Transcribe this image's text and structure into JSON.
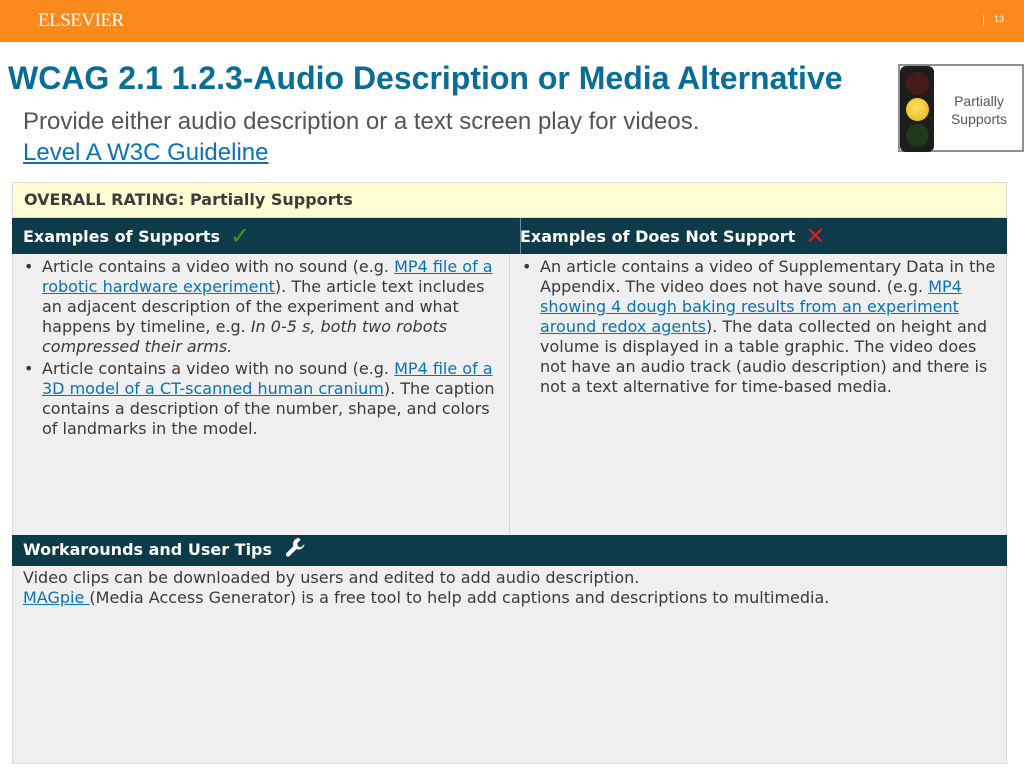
{
  "header": {
    "brand": "ELSEVIER",
    "page_number": "13"
  },
  "slide": {
    "title": "WCAG 2.1 1.2.3-Audio Description or Media Alternative",
    "subtitle": "Provide either audio description or a text screen play for videos.",
    "guideline_link": "Level A W3C Guideline"
  },
  "traffic_light": {
    "state": "yellow",
    "label_line1": "Partially",
    "label_line2": "Supports"
  },
  "table": {
    "rating": "OVERALL RATING: Partially Supports",
    "supports_header": "Examples of Supports",
    "not_supports_header": "Examples of Does Not Support",
    "supports_icon": "check-icon",
    "not_supports_icon": "cross-icon",
    "supports_items": [
      {
        "pre": "Article contains a video with no sound (e.g. ",
        "link": "MP4 file of a robotic hardware experiment",
        "mid": "). The article text includes an adjacent description of the experiment and what happens by timeline, e.g. ",
        "italic": "In 0-5 s, both two robots compressed their arms."
      },
      {
        "pre": "Article contains a video with no sound (e.g. ",
        "link": "MP4 file of a 3D model of a CT-scanned human cranium",
        "post": "). The caption contains a description of the number, shape, and colors of landmarks in the model."
      }
    ],
    "not_supports_items": [
      {
        "pre": "An article contains a video of Supplementary Data in the Appendix. The video does not have sound. (e.g. ",
        "link": "MP4 showing 4 dough baking results from an experiment around redox agents",
        "post": ").  The data collected on height and volume is displayed in a table graphic. The video does not have an audio track (audio description) and there is not a text alternative for time-based media."
      }
    ],
    "workarounds_header": "Workarounds and User Tips",
    "workarounds_icon": "wrench-icon",
    "workarounds_line1": "Video clips can be downloaded by users and edited to add audio description.",
    "workarounds_link": "MAGpie ",
    "workarounds_line2": "(Media Access Generator) is a free tool to help add captions and descriptions to multimedia."
  },
  "colors": {
    "topbar": "#f98a1b",
    "title": "#0a6d96",
    "header_bg": "#0d3b4a",
    "rating_bg": "#fffdd4",
    "link": "#0a73b4"
  }
}
